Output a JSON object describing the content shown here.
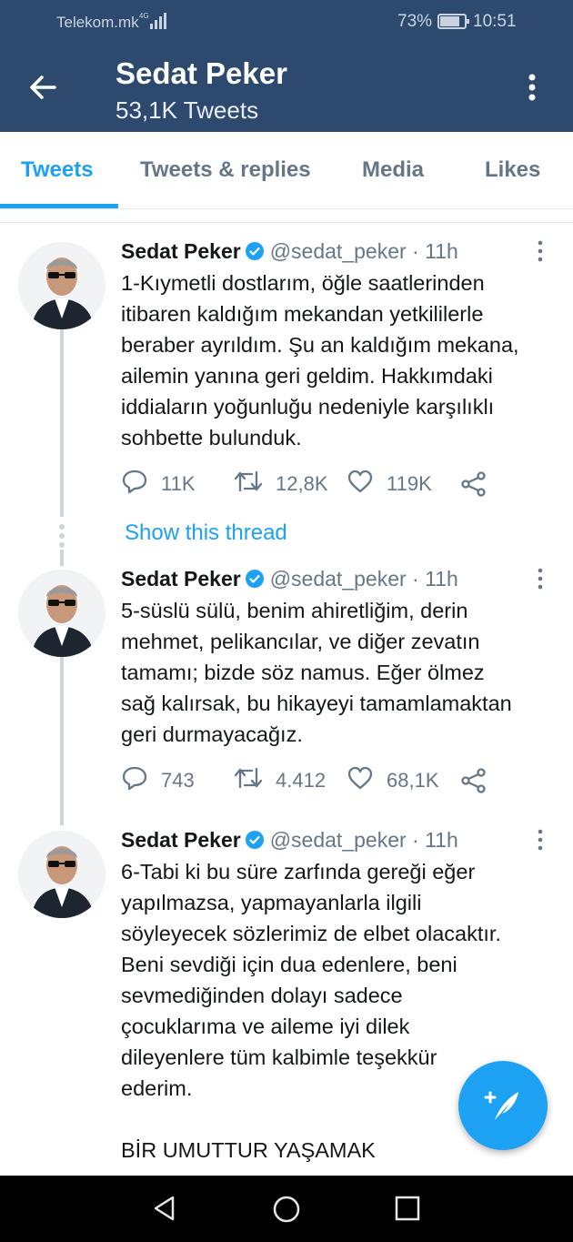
{
  "status_bar": {
    "carrier": "Telekom.mk",
    "network": "4G",
    "battery": "73%",
    "time": "10:51"
  },
  "header": {
    "title": "Sedat Peker",
    "subtitle": "53,1K Tweets"
  },
  "tabs": [
    {
      "label": "Tweets",
      "active": true
    },
    {
      "label": "Tweets & replies",
      "active": false
    },
    {
      "label": "Media",
      "active": false
    },
    {
      "label": "Likes",
      "active": false
    }
  ],
  "tweets": [
    {
      "name": "Sedat Peker",
      "handle": "@sedat_peker",
      "time": "· 11h",
      "text": "1-Kıymetli dostlarım, öğle saatlerinden\nitibaren kaldığım mekandan yetkililerle\nberaber ayrıldım. Şu an kaldığım mekana,\nailemin yanına geri geldim. Hakkımdaki\niddiaların yoğunluğu nedeniyle karşılıklı\nsohbette bulunduk.",
      "replies": "11K",
      "retweets": "12,8K",
      "likes": "119K"
    },
    {
      "name": "Sedat Peker",
      "handle": "@sedat_peker",
      "time": "· 11h",
      "text": "5-süslü sülü, benim ahiretliğim, derin\nmehmet, pelikancılar, ve diğer zevatın\ntamamı; bizde söz namus. Eğer ölmez\nsağ kalırsak, bu hikayeyi tamamlamaktan\ngeri durmayacağız.",
      "replies": "743",
      "retweets": "4.412",
      "likes": "68,1K"
    },
    {
      "name": "Sedat Peker",
      "handle": "@sedat_peker",
      "time": "· 11h",
      "text": "6-Tabi ki bu süre zarfında gereği eğer\nyapılmazsa, yapmayanlarla ilgili\nsöyleyecek sözlerimiz de elbet olacaktır.\nBeni sevdiği için dua edenlere, beni\nsevmediğinden dolayı sadece\nçocuklarıma ve aileme iyi dilek\ndileyenlere tüm kalbimle teşekkür\nederim.\n\nBİR UMUTTUR YAŞAMAK"
    }
  ],
  "show_thread": "Show this thread",
  "colors": {
    "header_bg": "#2d4a6e",
    "accent": "#1da1f2",
    "muted": "#657786"
  },
  "icons": [
    "back-arrow-icon",
    "more-vertical-icon",
    "verified-icon",
    "reply-icon",
    "retweet-icon",
    "like-icon",
    "share-icon",
    "compose-tweet-icon",
    "nav-back-icon",
    "nav-home-icon",
    "nav-recents-icon"
  ]
}
